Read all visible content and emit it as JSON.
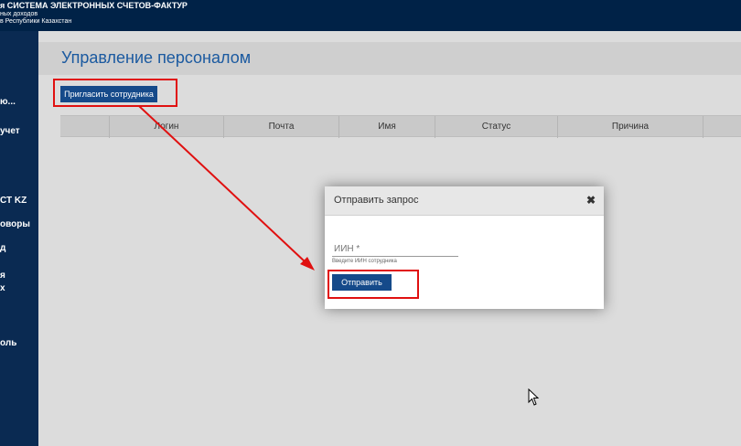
{
  "header": {
    "line1": "я СИСТЕМА ЭЛЕКТРОННЫХ СЧЕТОВ-ФАКТУР",
    "line2": "ных доходов",
    "line3": "в Республики Казахстан"
  },
  "sidebar": {
    "items": [
      {
        "label": "ю..."
      },
      {
        "label": "учет"
      },
      {
        "label": "СТ KZ"
      },
      {
        "label": "оворы"
      },
      {
        "label": "д"
      },
      {
        "label": "я"
      },
      {
        "label": "х"
      },
      {
        "label": "оль"
      }
    ]
  },
  "page": {
    "title": "Управление персоналом",
    "invite_button": "Пригласить сотрудника"
  },
  "table": {
    "columns": [
      "",
      "Логин",
      "Почта",
      "Имя",
      "Статус",
      "Причина",
      ""
    ]
  },
  "modal": {
    "title": "Отправить запрос",
    "close_icon": "close-icon",
    "iin_placeholder": "ИИН *",
    "iin_hint": "Введите ИИН сотрудника",
    "send_button": "Отправить"
  },
  "colors": {
    "header_bg": "#002247",
    "sidebar_bg": "#0a2a52",
    "accent": "#154a8a",
    "title": "#1b5aa0",
    "highlight": "#e01010"
  }
}
